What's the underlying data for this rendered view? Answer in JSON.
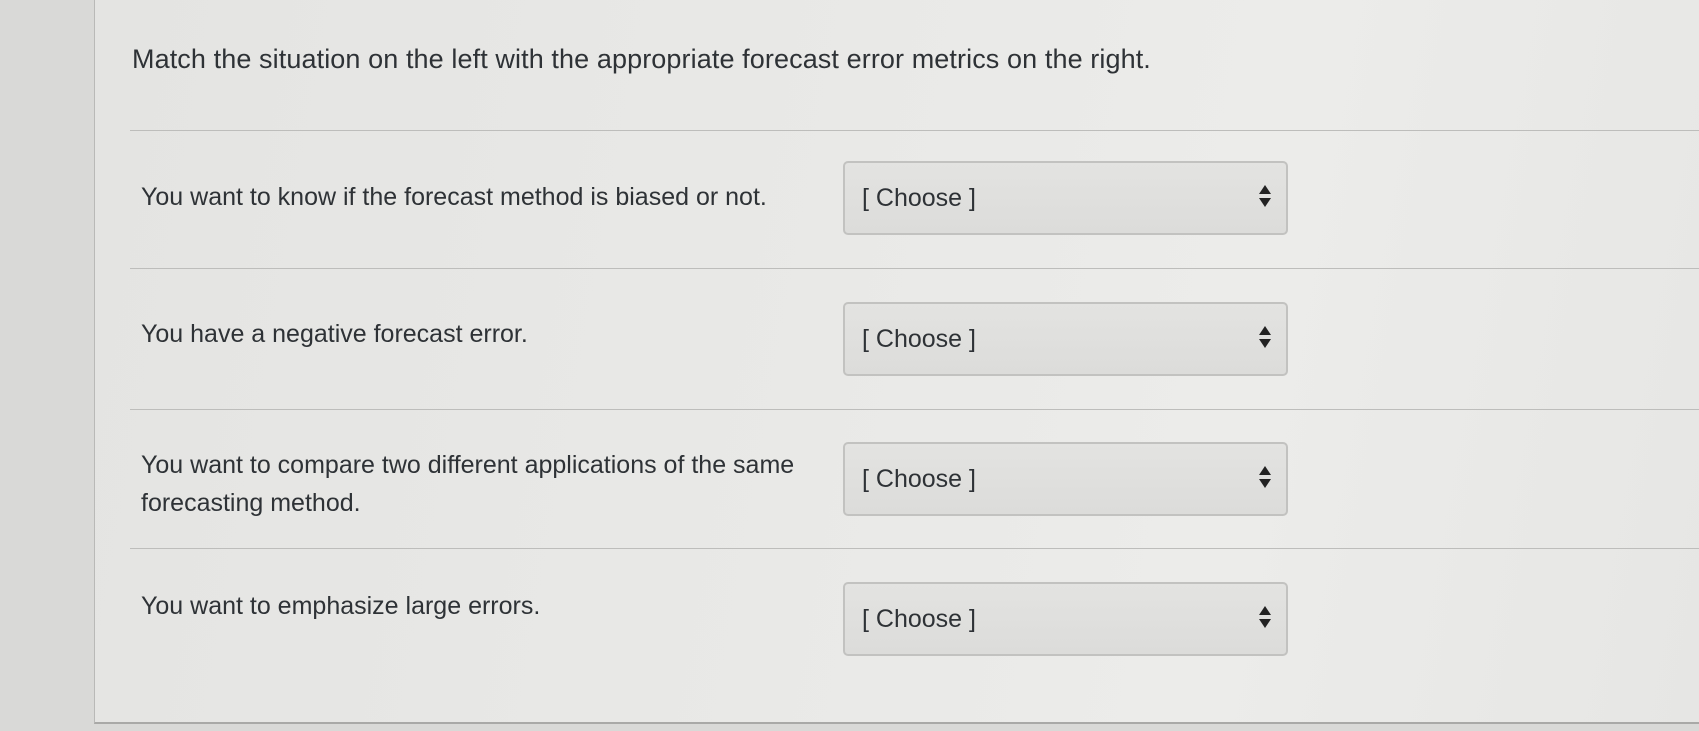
{
  "question": {
    "text": "Match the situation on the left with the appropriate forecast error metrics on the right."
  },
  "rows": [
    {
      "label": "You want to know if the forecast method is biased or not.",
      "select_value": "[ Choose ]"
    },
    {
      "label": "You have a negative forecast error.",
      "select_value": "[ Choose ]"
    },
    {
      "label": "You want to compare two different applications of the same forecasting method.",
      "select_value": "[ Choose ]"
    },
    {
      "label": "You want to emphasize large errors.",
      "select_value": "[ Choose ]"
    }
  ],
  "icons": {
    "select_arrows": "up-down-chevron-icon"
  }
}
